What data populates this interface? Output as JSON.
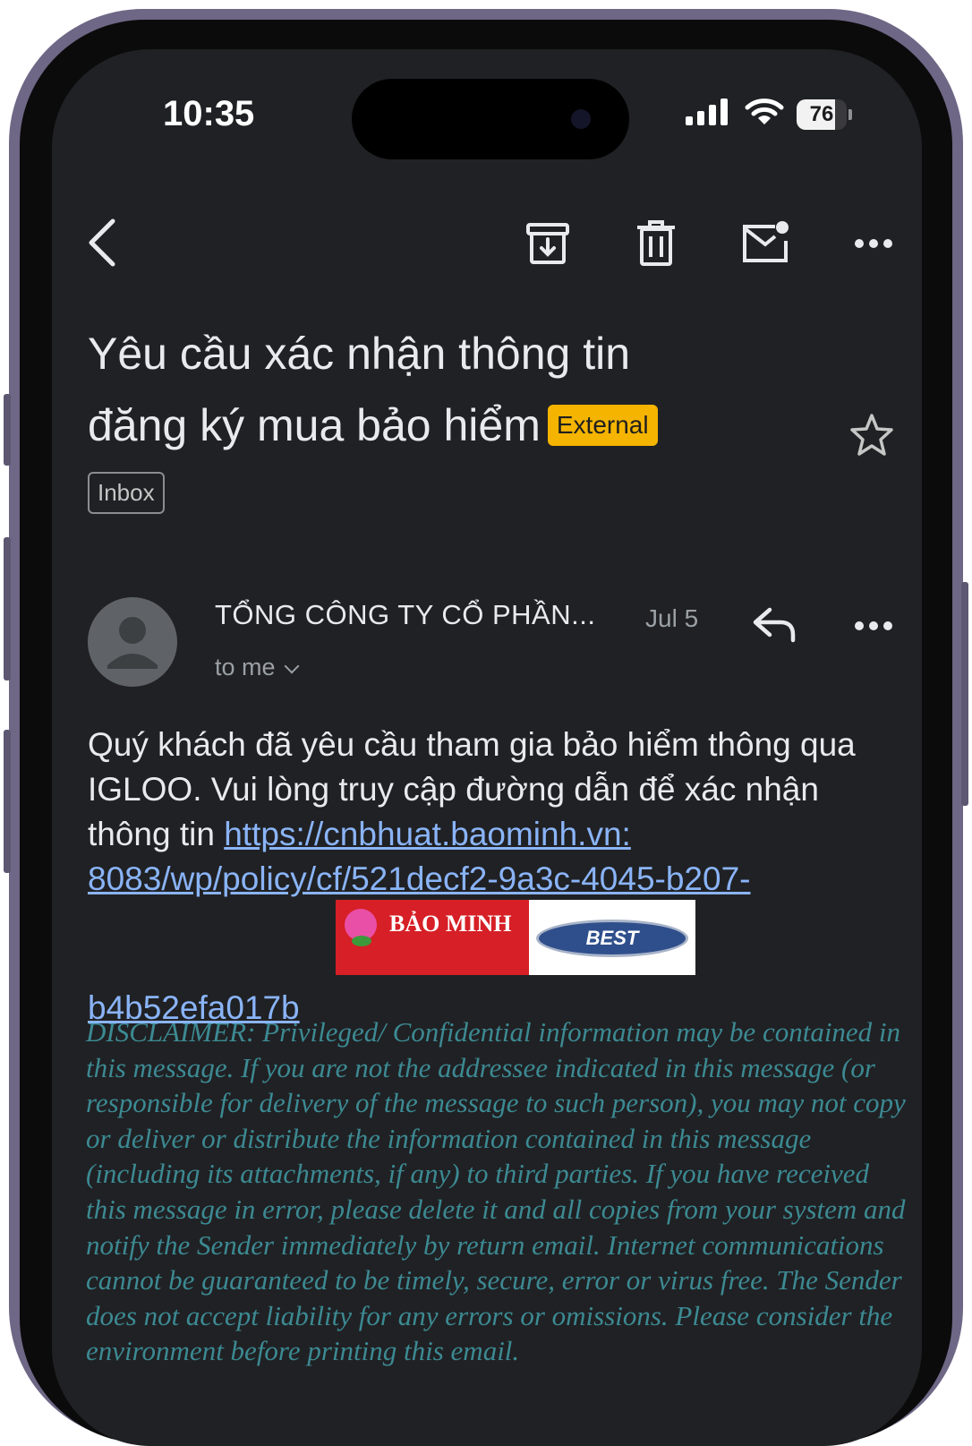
{
  "status_bar": {
    "time": "10:35",
    "battery": "76",
    "battery_level": 0.76,
    "icons": [
      "cellular-signal-icon",
      "wifi-icon",
      "battery-icon"
    ]
  },
  "toolbar": {
    "icons": [
      "back-arrow-icon",
      "archive-icon",
      "trash-icon",
      "mark-unread-icon",
      "more-icon"
    ]
  },
  "email": {
    "subject_line1": "Yêu cầu xác nhận thông tin",
    "subject_line2": "đăng ký mua bảo hiểm",
    "external_label": "External",
    "label": "Inbox",
    "sender": "TỔNG CÔNG TY CỔ PHẦN...",
    "date": "Jul 5",
    "recipient": "to me",
    "body_text": "Quý khách đã yêu cầu tham gia bảo hiểm thông qua IGLOO. Vui lòng truy cập đường dẫn để xác nhận thông tin ",
    "link_part1": "https://cnbhuat.baominh.vn:",
    "link_part2": "8083/wp/policy/cf/521decf2-9a3c-4045-b207-",
    "link_part3": "b4b52efa017b",
    "logo_text": "BẢO MINH",
    "badge_text": "BEST",
    "disclaimer": "DISCLAIMER: Privileged/ Confidential information may be contained in this message. If you are not the addressee indicated in this message (or responsible for delivery of the message to such person), you may not copy or deliver or distribute the information contained in this message (including its attachments, if any) to third parties. If you have received this message in error, please delete it and all copies from your system and notify the Sender immediately by return email. Internet communications cannot be guaranteed to be timely, secure, error or virus free. The Sender does not accept liability for any errors or omissions. Please consider the environment before printing this email."
  },
  "colors": {
    "background": "#202124",
    "external_badge": "#f4b400",
    "link": "#8ab4f8",
    "disclaimer": "#3c8a93"
  }
}
